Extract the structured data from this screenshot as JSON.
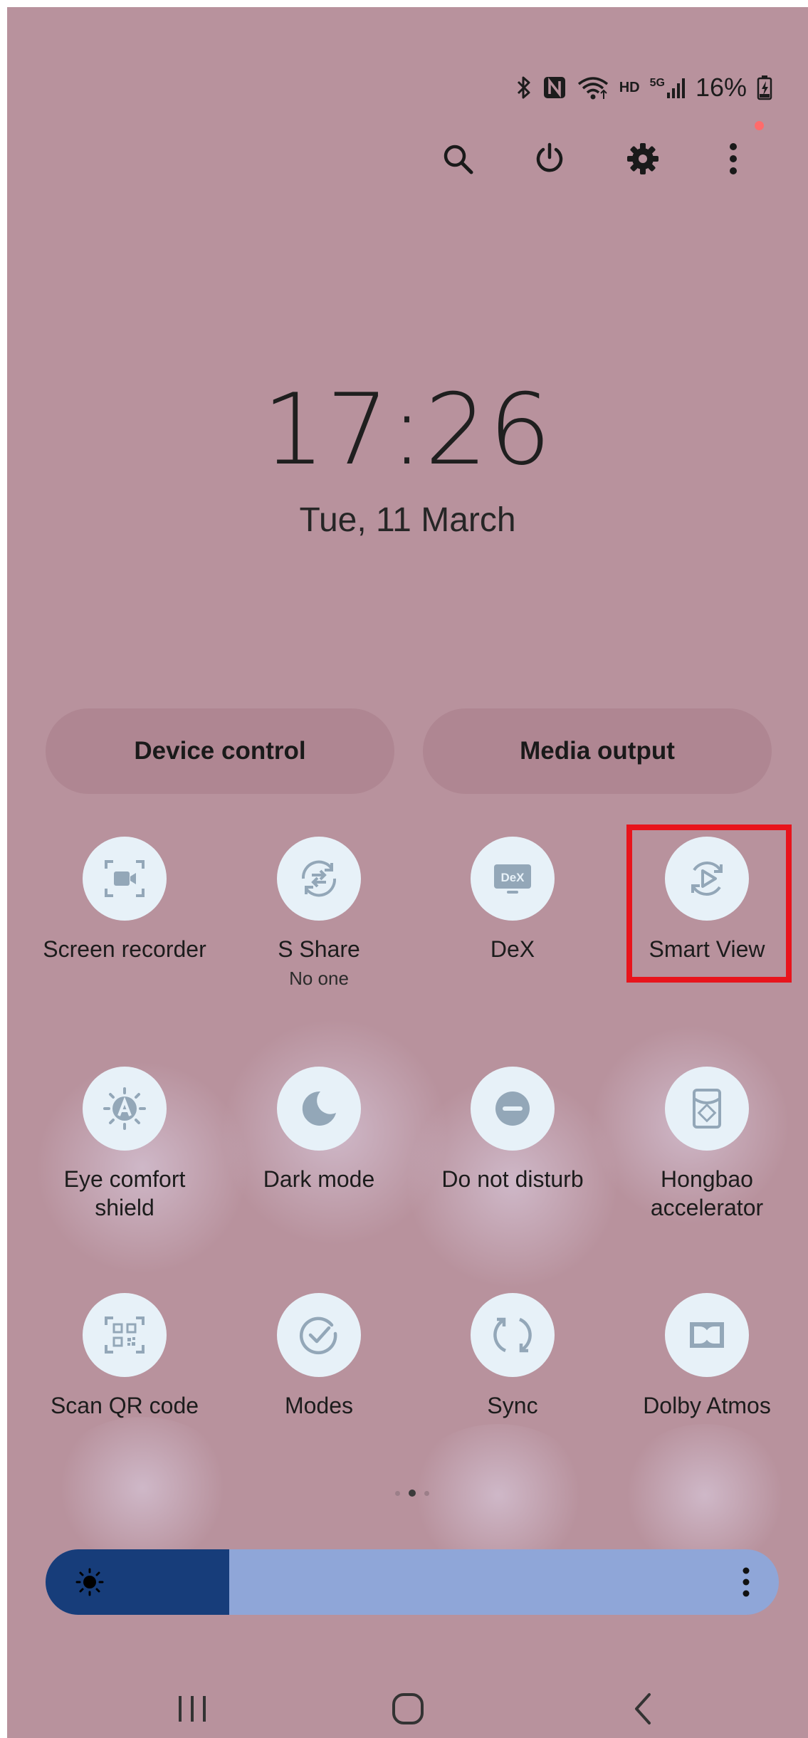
{
  "status_bar": {
    "network_badge": "HD",
    "signal_badge": "5G",
    "battery_percent": "16%",
    "icons": [
      "bluetooth-icon",
      "nfc-icon",
      "wifi-icon",
      "signal-icon",
      "battery-charging-icon"
    ]
  },
  "header_actions": [
    "search-icon",
    "power-icon",
    "gear-icon",
    "more-vertical-icon"
  ],
  "clock": {
    "time": "17:26",
    "date": "Tue, 11 March"
  },
  "buttons": {
    "device_control": "Device control",
    "media_output": "Media output"
  },
  "tiles": [
    {
      "label": "Screen recorder",
      "sub": "",
      "icon": "screen-recorder-icon"
    },
    {
      "label": "S Share",
      "sub": "No one",
      "icon": "s-share-icon"
    },
    {
      "label": "DeX",
      "sub": "",
      "icon": "dex-icon"
    },
    {
      "label": "Smart View",
      "sub": "",
      "icon": "smart-view-icon"
    },
    {
      "label": "Eye comfort shield",
      "sub": "",
      "icon": "eye-comfort-icon"
    },
    {
      "label": "Dark mode",
      "sub": "",
      "icon": "moon-icon"
    },
    {
      "label": "Do not disturb",
      "sub": "",
      "icon": "do-not-disturb-icon"
    },
    {
      "label": "Hongbao accelerator",
      "sub": "",
      "icon": "hongbao-icon"
    },
    {
      "label": "Scan QR code",
      "sub": "",
      "icon": "qr-code-icon"
    },
    {
      "label": "Modes",
      "sub": "",
      "icon": "modes-icon"
    },
    {
      "label": "Sync",
      "sub": "",
      "icon": "sync-icon"
    },
    {
      "label": "Dolby Atmos",
      "sub": "",
      "icon": "dolby-icon"
    }
  ],
  "dex_icon_text": "DeX",
  "page_indicator": {
    "pages": 3,
    "current": 2
  },
  "brightness": {
    "level": 0.25
  },
  "colors": {
    "background": "#b8929d",
    "tile_circle": "#e7f1f8",
    "tile_icon": "#93a7b8",
    "brightness_fill": "#173d7a",
    "brightness_track": "#8fa6d8",
    "highlight": "#e8141c",
    "notification_dot": "#ff6b6b"
  },
  "nav_bar": [
    "recent-apps-icon",
    "home-icon",
    "back-icon"
  ]
}
